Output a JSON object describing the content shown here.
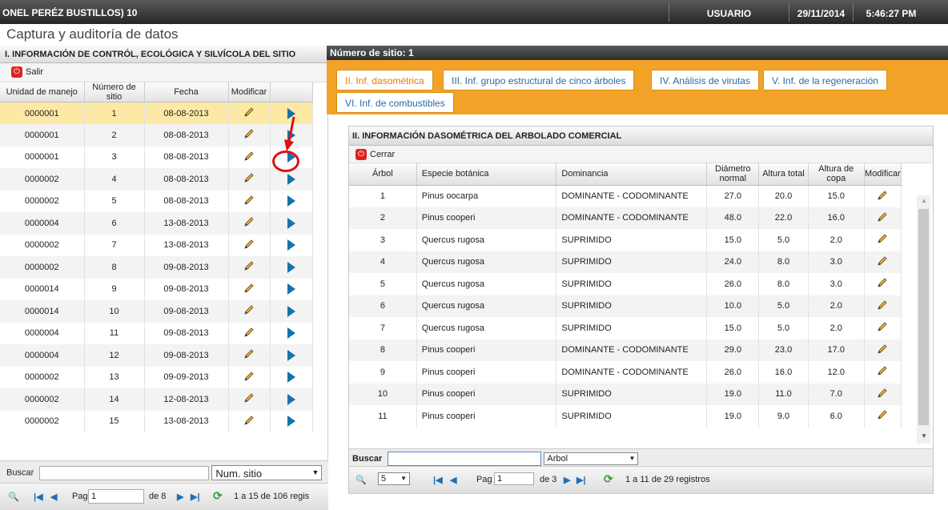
{
  "topbar": {
    "title": "ONEL PERÉZ BUSTILLOS) 10",
    "user_label": "USUARIO",
    "date": "29/11/2014",
    "time": "5:46:27 PM"
  },
  "subtitle": "Captura y auditoría de datos",
  "left": {
    "header": "I. INFORMACIÓN DE CONTRÓL, ECOLÓGICA Y SILVÍCOLA DEL SITIO",
    "exit_label": "Salir",
    "columns": [
      "Unidad de manejo",
      "Número de sitio",
      "Fecha",
      "Modificar",
      ""
    ],
    "rows": [
      [
        "0000001",
        "1",
        "08-08-2013"
      ],
      [
        "0000001",
        "2",
        "08-08-2013"
      ],
      [
        "0000001",
        "3",
        "08-08-2013"
      ],
      [
        "0000002",
        "4",
        "08-08-2013"
      ],
      [
        "0000002",
        "5",
        "08-08-2013"
      ],
      [
        "0000004",
        "6",
        "13-08-2013"
      ],
      [
        "0000002",
        "7",
        "13-08-2013"
      ],
      [
        "0000002",
        "8",
        "09-08-2013"
      ],
      [
        "0000014",
        "9",
        "09-08-2013"
      ],
      [
        "0000014",
        "10",
        "09-08-2013"
      ],
      [
        "0000004",
        "11",
        "09-08-2013"
      ],
      [
        "0000004",
        "12",
        "09-08-2013"
      ],
      [
        "0000002",
        "13",
        "09-09-2013"
      ],
      [
        "0000002",
        "14",
        "12-08-2013"
      ],
      [
        "0000002",
        "15",
        "13-08-2013"
      ]
    ],
    "search_label": "Buscar",
    "search_field": "Num. sitio",
    "pager_page_label": "Pag",
    "pager_page": "1",
    "pager_of": "de 8",
    "pager_info": "1 a 15 de 106 regis"
  },
  "right": {
    "site_label": "Número de sitio:",
    "site_number": "1",
    "tabs": [
      "II. Inf. dasométrica",
      "III. Inf. grupo estructural de cinco árboles",
      "IV. Análisis de virutas",
      "V. Inf. de la regeneración",
      "VI. Inf. de combustibles"
    ],
    "panel_title": "II. INFORMACIÓN DASOMÉTRICA DEL ARBOLADO COMERCIAL",
    "close_label": "Cerrar",
    "columns": [
      "Árbol",
      "Especie botánica",
      "Dominancia",
      "Diámetro normal",
      "Altura total",
      "Altura de copa",
      "Modificar"
    ],
    "rows": [
      [
        "1",
        "Pinus oocarpa",
        "DOMINANTE - CODOMINANTE",
        "27.0",
        "20.0",
        "15.0"
      ],
      [
        "2",
        "Pinus cooperi",
        "DOMINANTE - CODOMINANTE",
        "48.0",
        "22.0",
        "16.0"
      ],
      [
        "3",
        "Quercus rugosa",
        "SUPRIMIDO",
        "15.0",
        "5.0",
        "2.0"
      ],
      [
        "4",
        "Quercus rugosa",
        "SUPRIMIDO",
        "24.0",
        "8.0",
        "3.0"
      ],
      [
        "5",
        "Quercus rugosa",
        "SUPRIMIDO",
        "26.0",
        "8.0",
        "3.0"
      ],
      [
        "6",
        "Quercus rugosa",
        "SUPRIMIDO",
        "10.0",
        "5.0",
        "2.0"
      ],
      [
        "7",
        "Quercus rugosa",
        "SUPRIMIDO",
        "15.0",
        "5.0",
        "2.0"
      ],
      [
        "8",
        "Pinus cooperi",
        "DOMINANTE - CODOMINANTE",
        "29.0",
        "23.0",
        "17.0"
      ],
      [
        "9",
        "Pinus cooperi",
        "DOMINANTE - CODOMINANTE",
        "26.0",
        "16.0",
        "12.0"
      ],
      [
        "10",
        "Pinus cooperi",
        "SUPRIMIDO",
        "19.0",
        "11.0",
        "7.0"
      ],
      [
        "11",
        "Pinus cooperi",
        "SUPRIMIDO",
        "19.0",
        "9.0",
        "6.0"
      ]
    ],
    "search_label": "Buscar",
    "search_value": "",
    "search_field": "Arbol",
    "page_size": "5",
    "pager_page_label": "Pag",
    "pager_page": "1",
    "pager_of": "de 3",
    "pager_info": "1 a 11 de 29 registros"
  }
}
